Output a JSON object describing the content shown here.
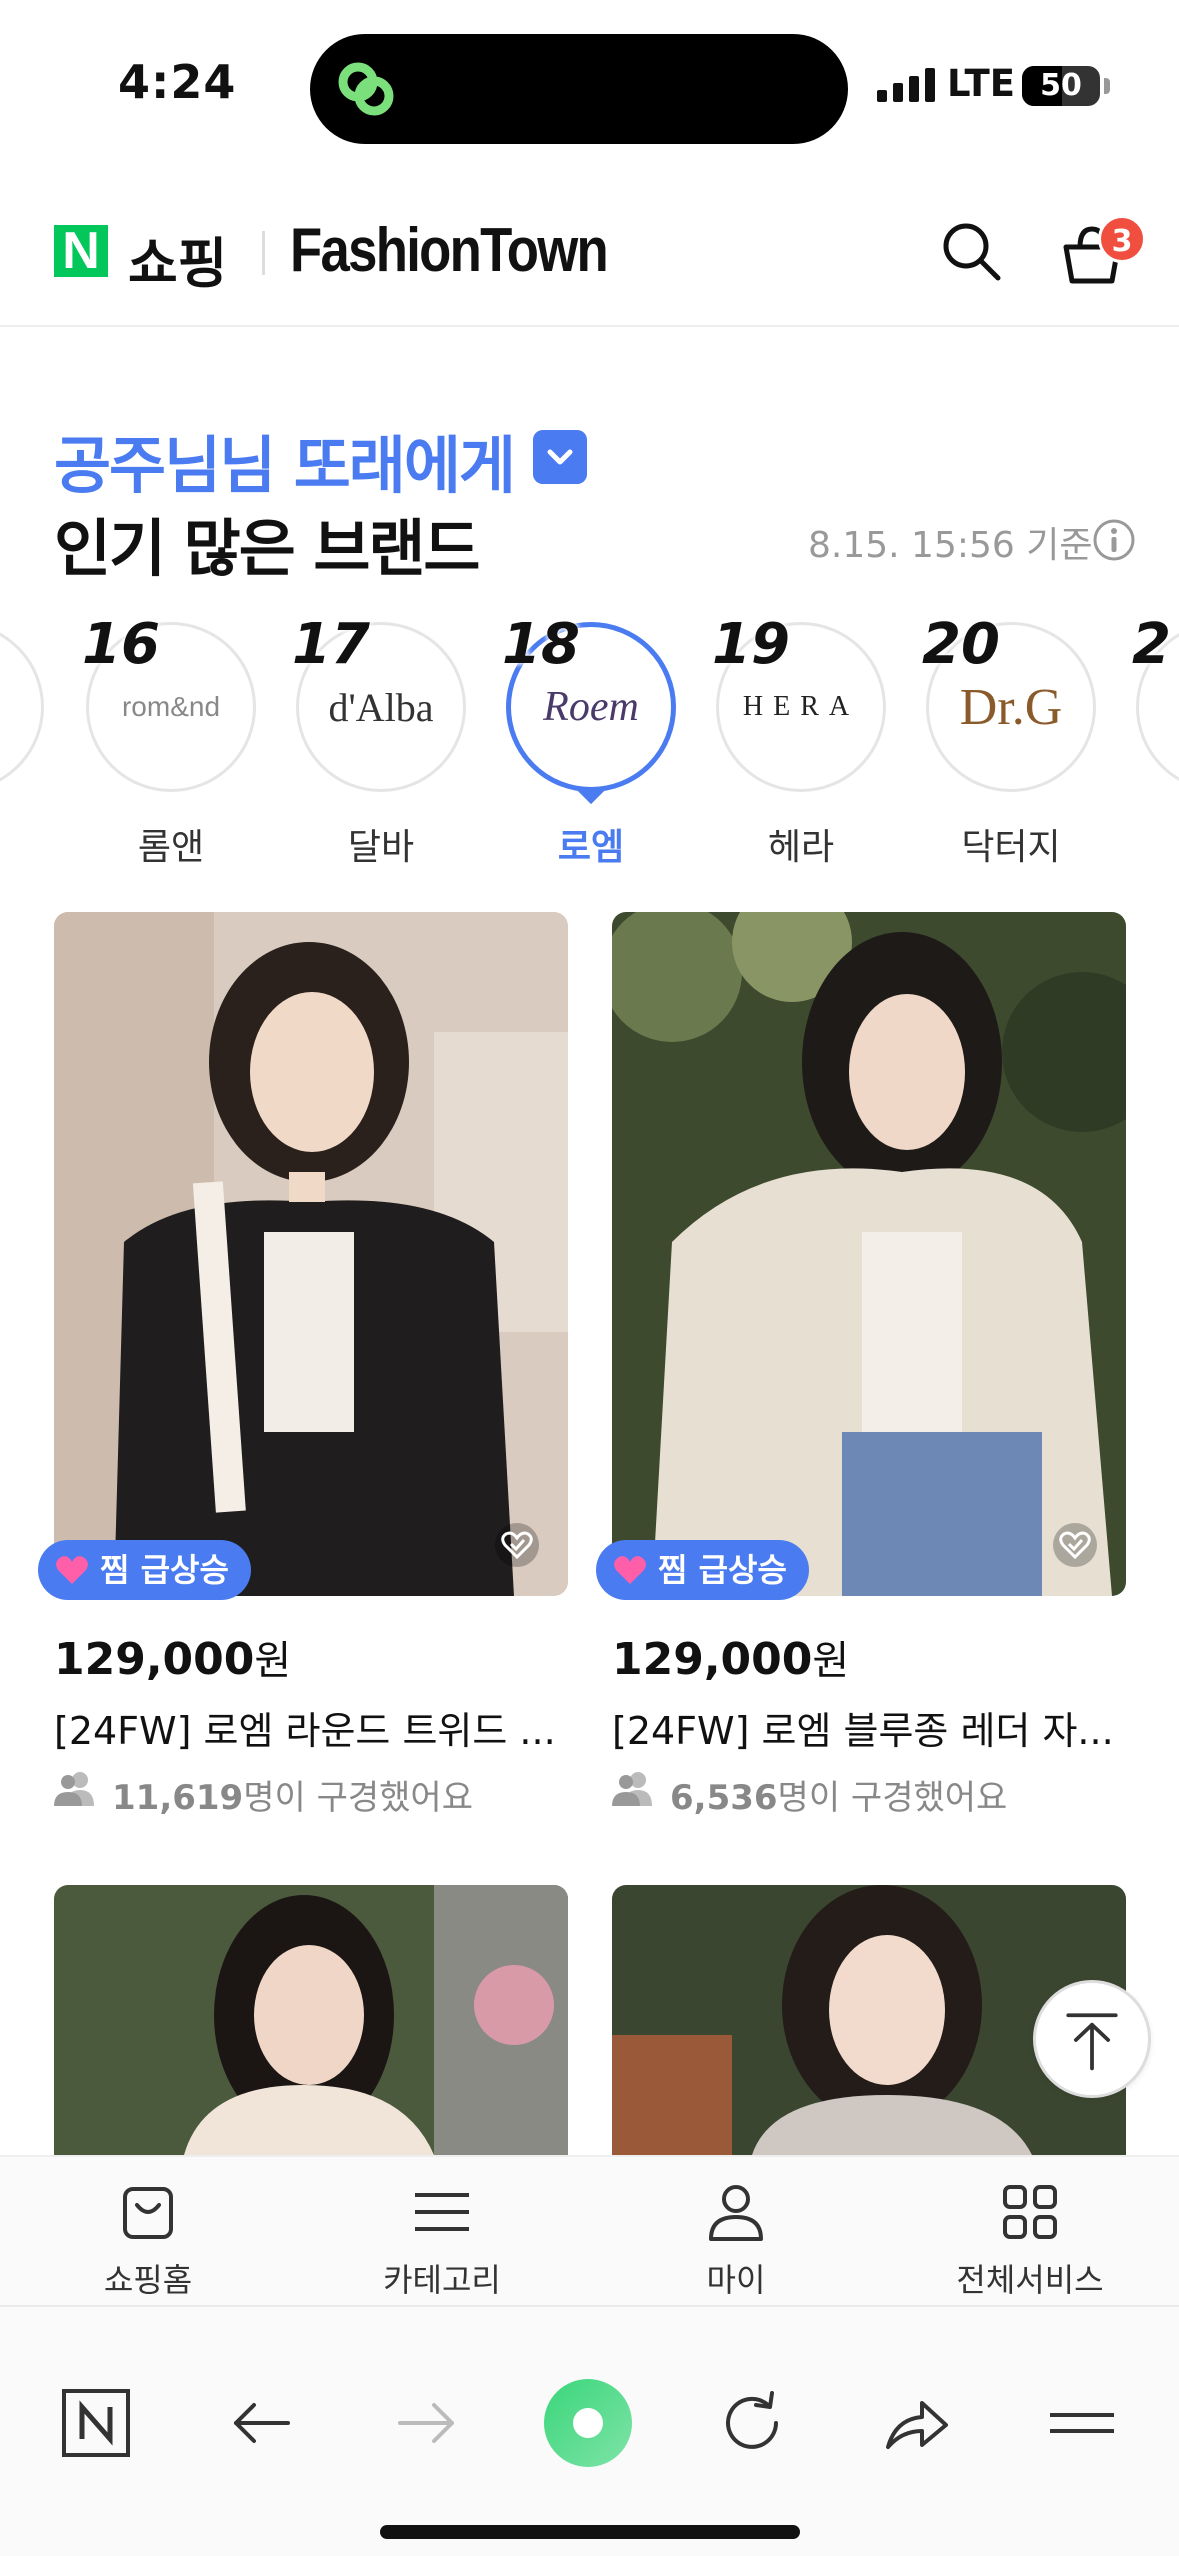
{
  "status_bar": {
    "time": "4:24",
    "network": "LTE",
    "battery": "50"
  },
  "header": {
    "service_logo": "N",
    "service_label": "쇼핑",
    "brand_title": "FashionTown",
    "cart_count": "3"
  },
  "section": {
    "title_line1": "공주님님 또래에게",
    "title_line2": "인기 많은 브랜드",
    "timestamp": "8.15. 15:56 기준"
  },
  "brands": [
    {
      "rank": "",
      "name": "",
      "logo": ""
    },
    {
      "rank": "16",
      "name": "롬앤",
      "logo": "rom&nd"
    },
    {
      "rank": "17",
      "name": "달바",
      "logo": "d'Alba"
    },
    {
      "rank": "18",
      "name": "로엠",
      "logo": "Roem",
      "active": true
    },
    {
      "rank": "19",
      "name": "헤라",
      "logo": "HERA"
    },
    {
      "rank": "20",
      "name": "닥터지",
      "logo": "Dr.G"
    },
    {
      "rank": "2",
      "name": "",
      "logo": ""
    }
  ],
  "products": [
    {
      "badge": "찜 급상승",
      "price": "129,000",
      "currency": "원",
      "name": "[24FW] 로엠 라운드 트위드 ...",
      "views_count": "11,619",
      "views_suffix": "명이 구경했어요"
    },
    {
      "badge": "찜 급상승",
      "price": "129,000",
      "currency": "원",
      "name": "[24FW] 로엠 블루종 레더 자...",
      "views_count": "6,536",
      "views_suffix": "명이 구경했어요"
    }
  ],
  "bottom_nav": [
    {
      "label": "쇼핑홈",
      "icon": "shopping-bag-icon"
    },
    {
      "label": "카테고리",
      "icon": "menu-icon"
    },
    {
      "label": "마이",
      "icon": "person-icon"
    },
    {
      "label": "전체서비스",
      "icon": "grid-icon"
    }
  ],
  "colors": {
    "accent": "#4a7bf0",
    "naver_green": "#03c75a",
    "badge_red": "#f04e3e"
  }
}
